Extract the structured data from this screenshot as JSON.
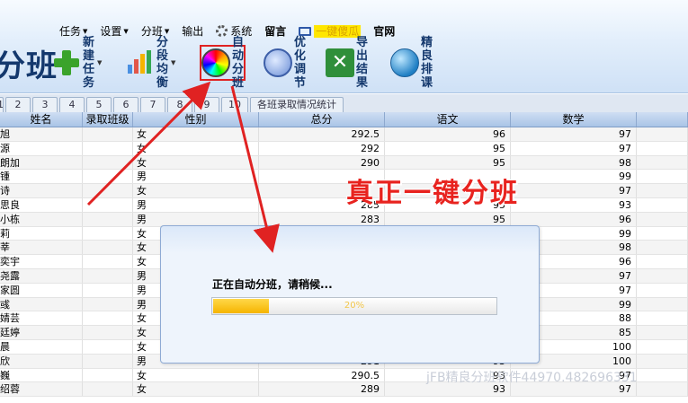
{
  "header": {
    "logo_text": "分班",
    "menu": [
      {
        "label": "任务",
        "has_dropdown": true
      },
      {
        "label": "设置",
        "has_dropdown": true
      },
      {
        "label": "分班",
        "has_dropdown": true
      },
      {
        "label": "输出",
        "has_dropdown": false
      },
      {
        "label": "系统",
        "has_dropdown": false,
        "icon": "gear-icon"
      },
      {
        "label": "留言",
        "has_dropdown": false,
        "bold": true
      },
      {
        "label": "一键傻瓜",
        "has_dropdown": false,
        "icon": "book-icon",
        "highlight": true
      },
      {
        "label": "官网",
        "has_dropdown": false,
        "bold": true
      }
    ],
    "toolbar": [
      {
        "line1": "新建",
        "line2": "任务",
        "icon": "plus-icon",
        "has_dropdown": true
      },
      {
        "line1": "分段",
        "line2": "均衡",
        "icon": "bar-chart-icon",
        "has_dropdown": true
      },
      {
        "line1": "自动",
        "line2": "分班",
        "icon": "color-wheel-icon",
        "has_dropdown": false,
        "active": true
      },
      {
        "line1": "优化",
        "line2": "调节",
        "icon": "optimize-icon",
        "has_dropdown": false
      },
      {
        "line1": "导出",
        "line2": "结果",
        "icon": "excel-icon",
        "has_dropdown": false
      },
      {
        "line1": "精良",
        "line2": "排课",
        "icon": "globe-icon",
        "has_dropdown": false
      }
    ]
  },
  "tabs": [
    "1",
    "2",
    "3",
    "4",
    "5",
    "6",
    "7",
    "8",
    "9",
    "10",
    "各班录取情况统计"
  ],
  "table": {
    "columns": [
      "姓名",
      "录取班级",
      "性别",
      "总分",
      "语文",
      "数学"
    ],
    "rows": [
      {
        "name": "旭",
        "class": "",
        "gender": "女",
        "total": "292.5",
        "chinese": "96",
        "math": "97"
      },
      {
        "name": "源",
        "class": "",
        "gender": "女",
        "total": "292",
        "chinese": "95",
        "math": "97"
      },
      {
        "name": "朗加",
        "class": "",
        "gender": "女",
        "total": "290",
        "chinese": "95",
        "math": "98"
      },
      {
        "name": "锺",
        "class": "",
        "gender": "男",
        "total": "",
        "chinese": "",
        "math": "99"
      },
      {
        "name": "诗",
        "class": "",
        "gender": "女",
        "total": "",
        "chinese": "",
        "math": "97"
      },
      {
        "name": "思良",
        "class": "",
        "gender": "男",
        "total": "285",
        "chinese": "95",
        "math": "93"
      },
      {
        "name": "小栋",
        "class": "",
        "gender": "男",
        "total": "283",
        "chinese": "95",
        "math": "96"
      },
      {
        "name": "莉",
        "class": "",
        "gender": "女",
        "total": "",
        "chinese": "",
        "math": "99"
      },
      {
        "name": "莘",
        "class": "",
        "gender": "女",
        "total": "",
        "chinese": "",
        "math": "98"
      },
      {
        "name": "奕宇",
        "class": "",
        "gender": "女",
        "total": "",
        "chinese": "",
        "math": "96"
      },
      {
        "name": "尧露",
        "class": "",
        "gender": "男",
        "total": "",
        "chinese": "",
        "math": "97"
      },
      {
        "name": "家圆",
        "class": "",
        "gender": "男",
        "total": "",
        "chinese": "",
        "math": "97"
      },
      {
        "name": "彧",
        "class": "",
        "gender": "男",
        "total": "",
        "chinese": "",
        "math": "99"
      },
      {
        "name": "婧芸",
        "class": "",
        "gender": "女",
        "total": "",
        "chinese": "",
        "math": "88"
      },
      {
        "name": "廷婷",
        "class": "",
        "gender": "女",
        "total": "",
        "chinese": "",
        "math": "85"
      },
      {
        "name": "晨",
        "class": "",
        "gender": "女",
        "total": "",
        "chinese": "",
        "math": "100"
      },
      {
        "name": "欣",
        "class": "",
        "gender": "男",
        "total": "291",
        "chinese": "93",
        "math": "100"
      },
      {
        "name": "巍",
        "class": "",
        "gender": "女",
        "total": "290.5",
        "chinese": "93",
        "math": "97"
      },
      {
        "name": "绍蓉",
        "class": "",
        "gender": "女",
        "total": "289",
        "chinese": "93",
        "math": "97"
      }
    ]
  },
  "slogan": "真正一键分班",
  "dialog": {
    "message": "正在自动分班，请稍候...",
    "progress_percent": 20,
    "progress_label": "20%"
  },
  "watermark": "jFB精良分班软件44970.482696331",
  "colors": {
    "annotation_red": "#e02222",
    "progress_fill": "#f5b400",
    "header_text": "#14386d"
  }
}
